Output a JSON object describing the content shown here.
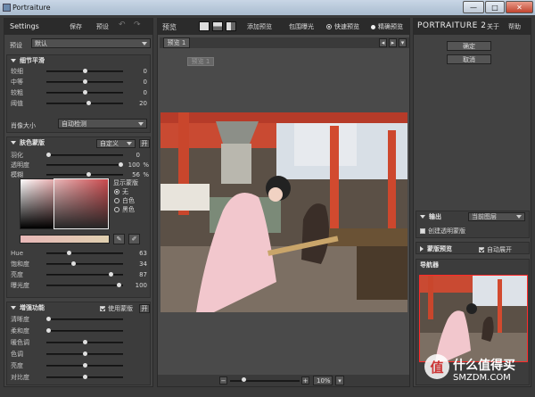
{
  "window": {
    "title": "Portraiture",
    "minimize": "—",
    "maximize": "□",
    "close": "✕"
  },
  "left": {
    "header": {
      "title": "Settings",
      "save": "保存",
      "preset": "预设"
    },
    "preset_label": "预设",
    "preset_value": "默认",
    "detail": {
      "title": "细节平滑",
      "sliders": [
        {
          "label": "较细",
          "value": "0",
          "pos": 0.5
        },
        {
          "label": "中等",
          "value": "0",
          "pos": 0.5
        },
        {
          "label": "较粗",
          "value": "0",
          "pos": 0.5
        },
        {
          "label": "阈值",
          "value": "20",
          "pos": 0.56
        }
      ],
      "portrait_size_label": "肖像大小",
      "portrait_size_value": "自动检测"
    },
    "skin": {
      "title": "肤色蒙版",
      "mode": "自定义",
      "toggle": "开",
      "sliders": [
        {
          "label": "羽化",
          "value": "0",
          "unit": "",
          "pos": 0.0
        },
        {
          "label": "透明度",
          "value": "100",
          "unit": "%",
          "pos": 1.0
        },
        {
          "label": "模糊",
          "value": "56",
          "unit": "%",
          "pos": 0.56
        }
      ],
      "show_mask_label": "显示蒙版",
      "options": [
        "无",
        "白色",
        "黑色"
      ],
      "selected": 0,
      "hsl": [
        {
          "label": "Hue",
          "value": "63",
          "pos": 0.28
        },
        {
          "label": "饱和度",
          "value": "34",
          "pos": 0.34
        },
        {
          "label": "亮度",
          "value": "87",
          "pos": 0.87
        },
        {
          "label": "曝光度",
          "value": "100",
          "pos": 0.98
        }
      ]
    },
    "enhance": {
      "title": "增强功能",
      "use_mask": "使用蒙版",
      "toggle": "开",
      "sliders": [
        {
          "label": "清晰度",
          "value": "",
          "pos": 0.0
        },
        {
          "label": "柔和度",
          "value": "",
          "pos": 0.0
        },
        {
          "label": "暖色调",
          "value": "",
          "pos": 0.5
        },
        {
          "label": "色调",
          "value": "",
          "pos": 0.5
        },
        {
          "label": "亮度",
          "value": "",
          "pos": 0.5
        },
        {
          "label": "对比度",
          "value": "",
          "pos": 0.5
        }
      ]
    }
  },
  "center": {
    "toolbar": {
      "preview": "预览",
      "add_preview": "添加预览",
      "clip_exposure": "包围曝光",
      "fast_preview": "快速预览",
      "precise_preview": "精确预览",
      "fast_selected": true
    },
    "tab": "预览 1",
    "ghost_tag": "预览 1",
    "zoom": {
      "value": "10%",
      "minus": "−",
      "plus": "+",
      "pos": 0.18
    }
  },
  "right": {
    "brand": "PORTRAITURE 2",
    "about": "关于",
    "help": "帮助",
    "ok": "确定",
    "cancel": "取消",
    "output": {
      "label": "输出",
      "value": "当前图层",
      "create_mask": "创建透明蒙版"
    },
    "mask_preview": {
      "label": "蒙版预览",
      "auto_expand": "自动展开"
    },
    "navigator": "导航器"
  },
  "watermark": {
    "text1": "什么值得买",
    "text2": "SMZDM.COM",
    "logo": "值"
  }
}
